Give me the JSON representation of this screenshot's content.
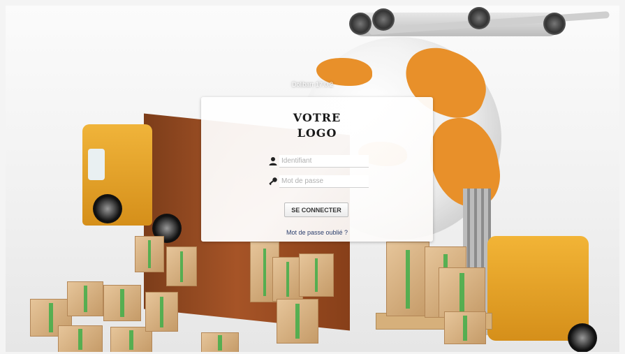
{
  "app": {
    "version": "Dolibarr 17.0.2"
  },
  "login": {
    "logo_line1": "VOTRE",
    "logo_line2": "LOGO",
    "username_placeholder": "Identifiant",
    "password_placeholder": "Mot de passe",
    "submit_label": "SE CONNECTER",
    "forgot_password_label": "Mot de passe oublié ?",
    "username_icon": "user-icon",
    "password_icon": "key-icon"
  },
  "colors": {
    "accent_orange": "#e8902a",
    "link": "#2a3d6b"
  }
}
